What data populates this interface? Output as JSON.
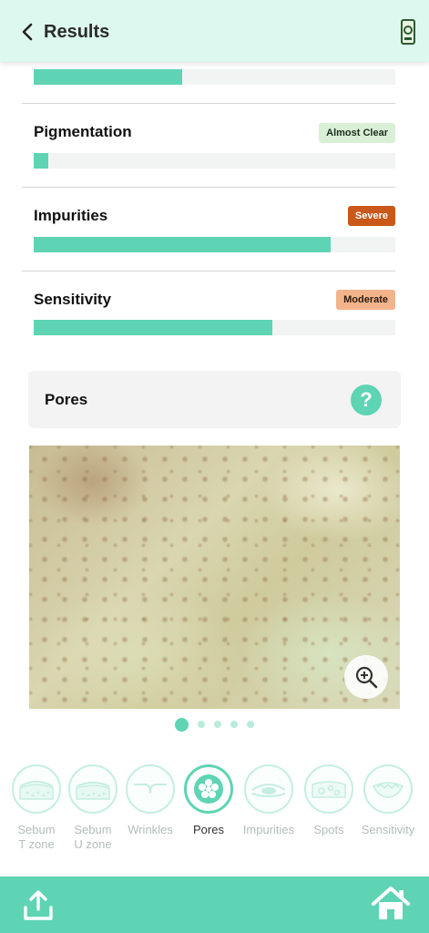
{
  "header": {
    "title": "Results",
    "back_icon": "chevron-left-icon",
    "device_icon": "device-icon"
  },
  "metrics": [
    {
      "name": "",
      "badge": "",
      "level": 0.41
    },
    {
      "name": "Pigmentation",
      "badge": "Almost Clear",
      "badge_bg": "#d9efd6",
      "badge_color": "#1e2e1e",
      "level": 0.04
    },
    {
      "name": "Impurities",
      "badge": "Severe",
      "badge_bg": "#c9581a",
      "badge_color": "#ffffff",
      "level": 0.82
    },
    {
      "name": "Sensitivity",
      "badge": "Moderate",
      "badge_bg": "#f3b48b",
      "badge_color": "#2a1a10",
      "level": 0.66
    }
  ],
  "pores_card": {
    "title": "Pores",
    "help_label": "?"
  },
  "pager": {
    "count": 5,
    "active": 0
  },
  "categories": [
    {
      "label": "Sebum\nT zone",
      "icon": "sebum-t-zone-icon",
      "active": false
    },
    {
      "label": "Sebum\nU zone",
      "icon": "sebum-u-zone-icon",
      "active": false
    },
    {
      "label": "Wrinkles",
      "icon": "wrinkles-icon",
      "active": false
    },
    {
      "label": "Pores",
      "icon": "pores-icon",
      "active": true
    },
    {
      "label": "Impurities",
      "icon": "impurities-icon",
      "active": false
    },
    {
      "label": "Spots",
      "icon": "spots-icon",
      "active": false
    },
    {
      "label": "Sensitivity",
      "icon": "sensitivity-icon",
      "active": false
    }
  ],
  "colors": {
    "accent": "#5ed4b4",
    "header_bg": "#dcf8ef",
    "track": "#f2f4f4"
  }
}
